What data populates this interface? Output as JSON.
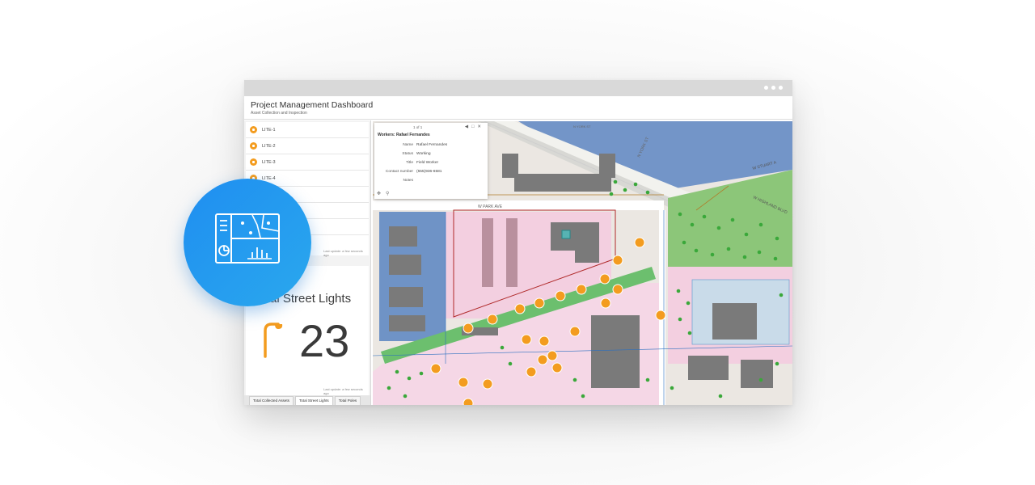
{
  "window": {
    "title": "Project Management Dashboard",
    "subtitle": "Asset Collection and Inspection"
  },
  "list": {
    "items": [
      "LITE-1",
      "LITE-2",
      "LITE-3",
      "LITE-4"
    ],
    "last_update": "Last update: a few seconds ago"
  },
  "indicator": {
    "title": "Total Street Lights",
    "value": "23",
    "last_update": "Last update: a few seconds ago",
    "icon": "street-light-icon"
  },
  "tabs": [
    {
      "label": "Total Collected Assets",
      "active": false
    },
    {
      "label": "Total Street Lights",
      "active": true
    },
    {
      "label": "Total Poles",
      "active": false
    }
  ],
  "popup": {
    "pager": "1 of 1",
    "title": "Workers: Rafael Fernandes",
    "fields": [
      {
        "key": "Name",
        "value": "Rafael Fernandes"
      },
      {
        "key": "Status",
        "value": "Working"
      },
      {
        "key": "Title",
        "value": "Field Worker"
      },
      {
        "key": "Contact number",
        "value": "(555)936-6581"
      },
      {
        "key": "Notes",
        "value": ""
      }
    ]
  },
  "map": {
    "streets": [
      "W PARK AVE",
      "N YORK ST",
      "W STUART A",
      "W HIGHLAND BLVD"
    ],
    "colors": {
      "blue_zone": "#6f93c6",
      "pink_zone": "#f3cfe0",
      "green_zone": "#7fbf6a",
      "building": "#7a7a7a",
      "marker": "#f39c1f",
      "tree": "#3aa83a"
    }
  },
  "badge": {
    "icon": "dashboard-icon",
    "color": "#2196f3"
  }
}
